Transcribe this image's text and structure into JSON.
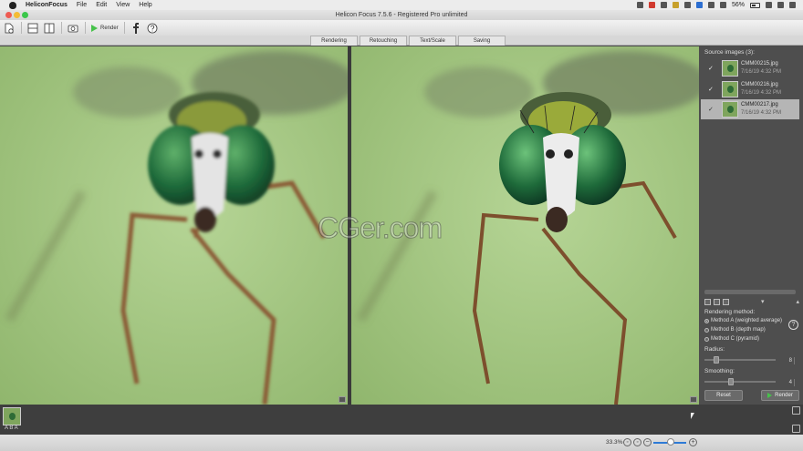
{
  "menubar": {
    "app_name": "HeliconFocus",
    "items": [
      "File",
      "Edit",
      "View",
      "Help"
    ],
    "battery": "56%"
  },
  "window": {
    "title": "Helicon Focus 7.5.6 - Registered Pro unlimited"
  },
  "toolbar": {
    "render_label": "Render"
  },
  "tabs": [
    "Rendering",
    "Retouching",
    "Text/Scale",
    "Saving"
  ],
  "watermark": "CGer.com",
  "panel": {
    "source_title": "Source images (3):",
    "sources": [
      {
        "name": "CMM00215.jpg",
        "date": "7/16/19 4:32 PM",
        "checked": "✓"
      },
      {
        "name": "CMM00216.jpg",
        "date": "7/16/19 4:32 PM",
        "checked": "✓"
      },
      {
        "name": "CMM00217.jpg",
        "date": "7/16/19 4:32 PM",
        "checked": "✓"
      }
    ],
    "method_label": "Rendering method:",
    "methods": [
      "Method A (weighted average)",
      "Method B (depth map)",
      "Method C (pyramid)"
    ],
    "selected_method": 0,
    "radius_label": "Radius:",
    "radius_value": "8",
    "smoothing_label": "Smoothing:",
    "smoothing_value": "4",
    "reset_label": "Reset",
    "render_label": "Render",
    "help_label": "?"
  },
  "filmstrip": {
    "label": "A B A"
  },
  "status": {
    "zoom": "33.3%"
  }
}
